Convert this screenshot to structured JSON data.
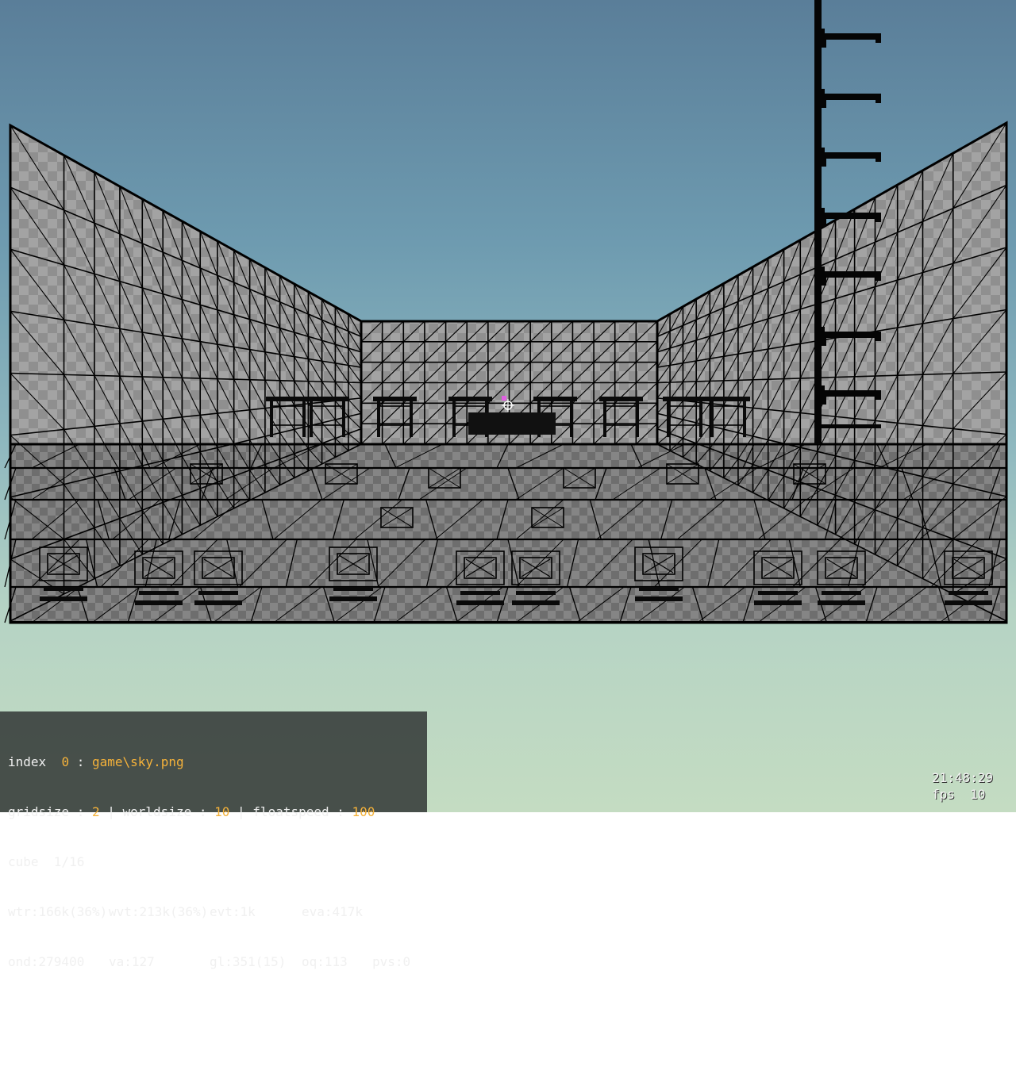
{
  "hud": {
    "line1": {
      "label": "index",
      "index_value": "0",
      "sep": ":",
      "texture": "game\\sky.png"
    },
    "line2": {
      "gridsize_label": "gridsize",
      "gridsize_value": "2",
      "worldsize_label": "worldsize",
      "worldsize_value": "10",
      "floatspeed_label": "floatspeed",
      "floatspeed_value": "100"
    },
    "line3": {
      "cube": "cube  1/16"
    },
    "stats1": {
      "wtr": "wtr:166k(36%)",
      "wvt": "wvt:213k(36%)",
      "evt": "evt:1k",
      "eva": "eva:417k"
    },
    "stats2": {
      "ond": "ond:279400",
      "va": "va:127",
      "gl": "gl:351(15)",
      "oq": "oq:113",
      "pvs": "pvs:0"
    }
  },
  "clock": {
    "time": "21:48:29",
    "fps": "fps  10"
  },
  "colors": {
    "highlight": "#f5b23a",
    "wire": "#000000",
    "wall": "#8c8c8c"
  }
}
